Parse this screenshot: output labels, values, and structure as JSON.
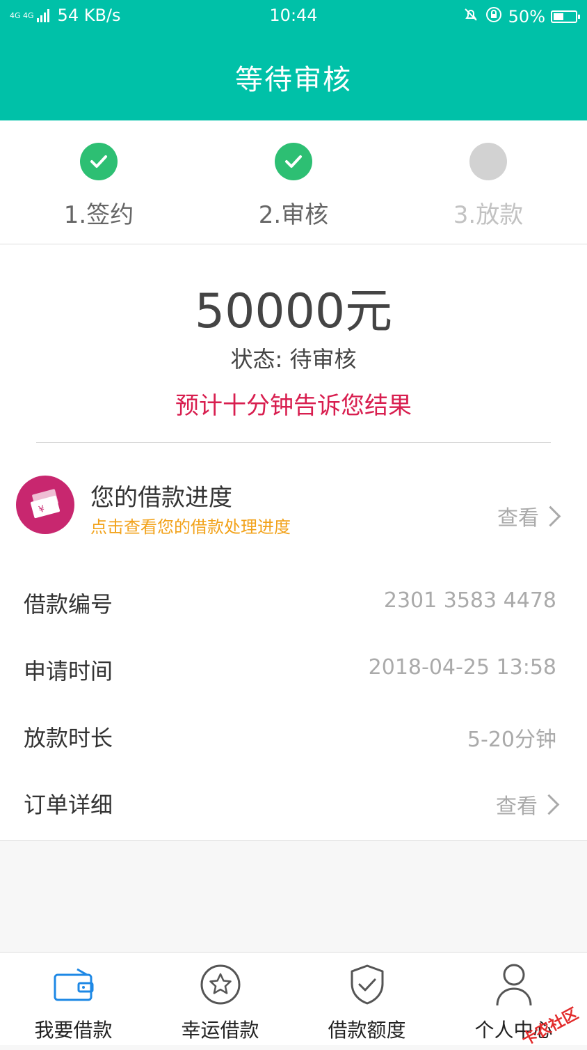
{
  "status_bar": {
    "network": "4G 4G",
    "speed": "54 KB/s",
    "time": "10:44",
    "battery": "50%",
    "battery_level": 0.5
  },
  "header": {
    "title": "等待审核"
  },
  "steps": [
    {
      "label": "1.签约",
      "state": "done"
    },
    {
      "label": "2.审核",
      "state": "done"
    },
    {
      "label": "3.放款",
      "state": "pending"
    }
  ],
  "summary": {
    "amount": "50000元",
    "status": "状态: 待审核",
    "hint": "预计十分钟告诉您结果"
  },
  "progress": {
    "title": "您的借款进度",
    "subtitle": "点击查看您的借款处理进度",
    "action": "查看"
  },
  "details": [
    {
      "key": "借款编号",
      "value": "2301 3583 4478"
    },
    {
      "key": "申请时间",
      "value": "2018-04-25 13:58"
    },
    {
      "key": "放款时长",
      "value": "5-20分钟"
    },
    {
      "key": "订单详细",
      "value": "查看"
    }
  ],
  "tabs": [
    {
      "label": "我要借款",
      "icon": "wallet-icon"
    },
    {
      "label": "幸运借款",
      "icon": "star-icon"
    },
    {
      "label": "借款额度",
      "icon": "shield-icon"
    },
    {
      "label": "个人中心",
      "icon": "user-icon"
    }
  ],
  "watermark": "卡农社区",
  "colors": {
    "primary": "#00c1a8",
    "done": "#2dbf73",
    "pending": "#d2d2d2",
    "hint": "#d81e4f",
    "progress_icon": "#c8276f",
    "tab_active": "#1e88e5"
  }
}
